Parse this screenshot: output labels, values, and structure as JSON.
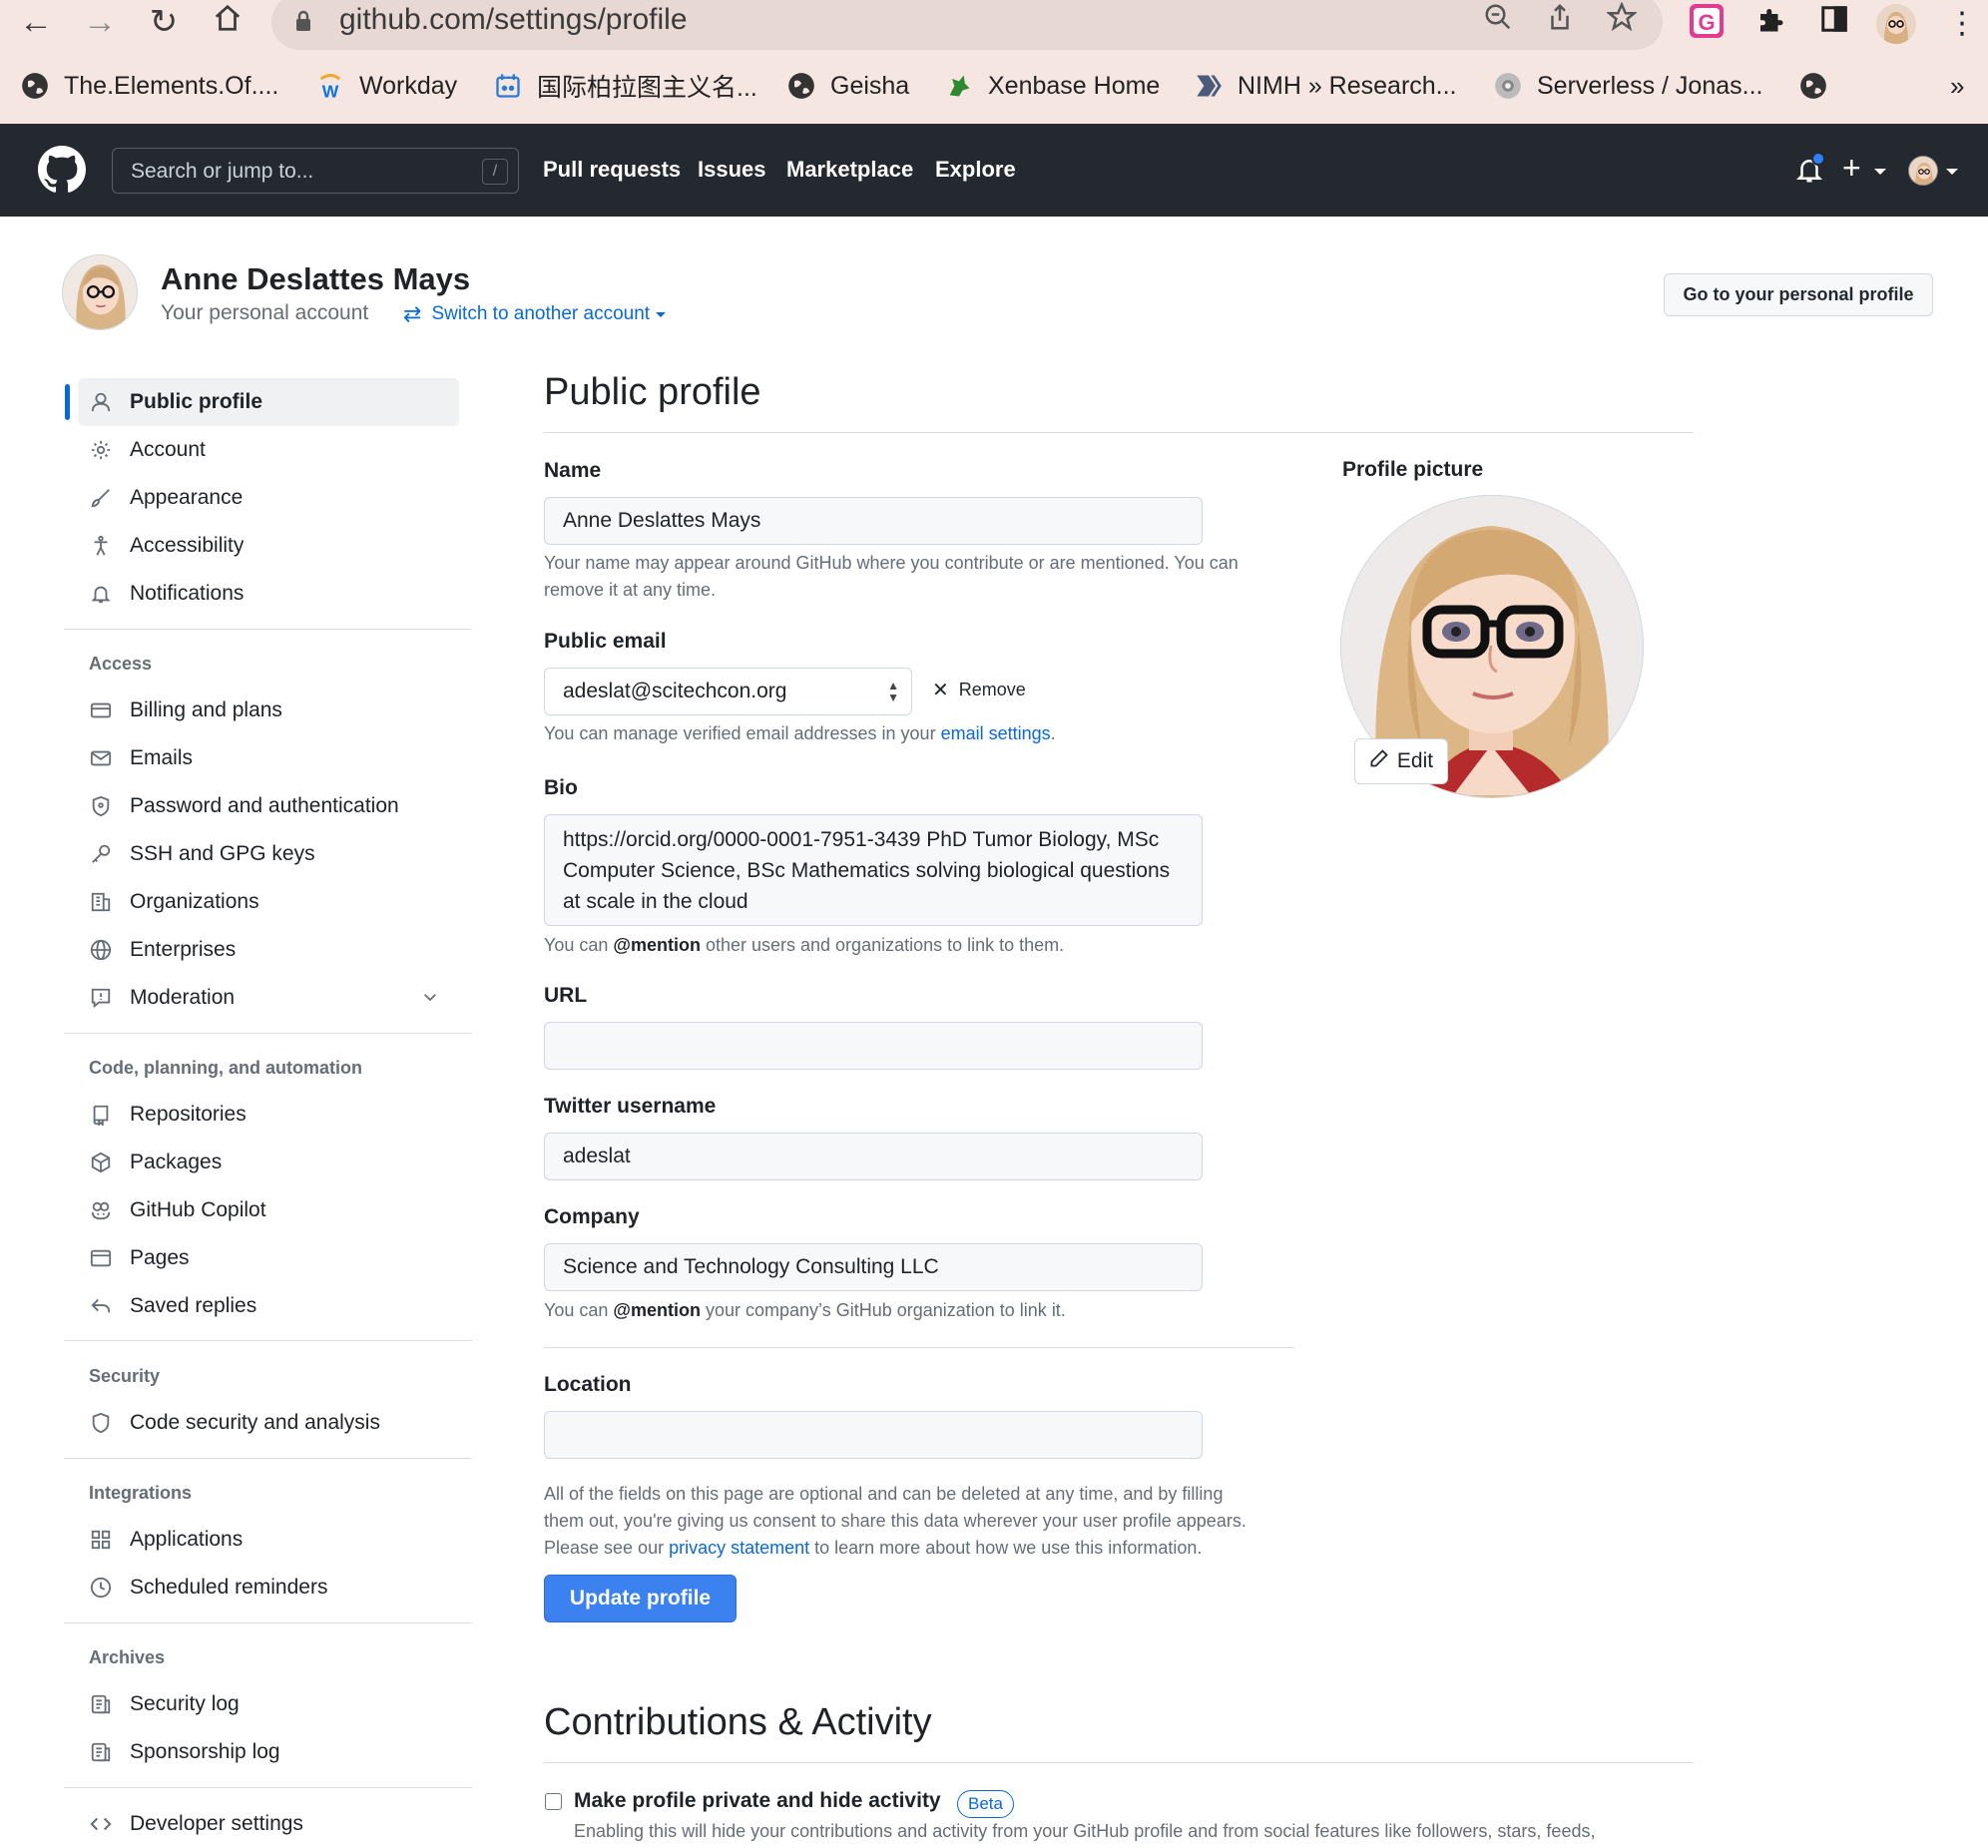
{
  "browser": {
    "url": "github.com/settings/profile",
    "bookmarks": [
      {
        "label": "The.Elements.Of...."
      },
      {
        "label": "Workday"
      },
      {
        "label": "国际柏拉图主义名..."
      },
      {
        "label": "Geisha"
      },
      {
        "label": "Xenbase Home"
      },
      {
        "label": "NIMH » Research..."
      },
      {
        "label": "Serverless / Jonas..."
      }
    ],
    "more": "»"
  },
  "header": {
    "search_placeholder": "Search or jump to...",
    "slash": "/",
    "nav": [
      "Pull requests",
      "Issues",
      "Marketplace",
      "Explore"
    ],
    "plus": "+"
  },
  "account": {
    "name": "Anne Deslattes Mays",
    "subtitle": "Your personal account",
    "switch": "Switch to another account",
    "go_profile": "Go to your personal profile"
  },
  "sidebar": {
    "top": [
      "Public profile",
      "Account",
      "Appearance",
      "Accessibility",
      "Notifications"
    ],
    "access_head": "Access",
    "access": [
      "Billing and plans",
      "Emails",
      "Password and authentication",
      "SSH and GPG keys",
      "Organizations",
      "Enterprises",
      "Moderation"
    ],
    "code_head": "Code, planning, and automation",
    "code": [
      "Repositories",
      "Packages",
      "GitHub Copilot",
      "Pages",
      "Saved replies"
    ],
    "security_head": "Security",
    "security": [
      "Code security and analysis"
    ],
    "integrations_head": "Integrations",
    "integrations": [
      "Applications",
      "Scheduled reminders"
    ],
    "archives_head": "Archives",
    "archives": [
      "Security log",
      "Sponsorship log"
    ],
    "developer": "Developer settings"
  },
  "main": {
    "title": "Public profile",
    "name_label": "Name",
    "name_value": "Anne Deslattes Mays",
    "name_note": "Your name may appear around GitHub where you contribute or are mentioned. You can remove it at any time.",
    "email_label": "Public email",
    "email_value": "adeslat@scitechcon.org",
    "remove": "Remove",
    "email_note_pre": "You can manage verified email addresses in your ",
    "email_note_link": "email settings",
    "email_note_post": ".",
    "bio_label": "Bio",
    "bio_value": "https://orcid.org/0000-0001-7951-3439 PhD Tumor Biology, MSc Computer Science, BSc Mathematics solving biological questions at scale in the cloud",
    "bio_note_pre": "You can ",
    "bio_note_mention": "@mention",
    "bio_note_post": " other users and organizations to link to them.",
    "url_label": "URL",
    "url_value": "",
    "twitter_label": "Twitter username",
    "twitter_value": "adeslat",
    "company_label": "Company",
    "company_value": "Science and Technology Consulting LLC",
    "company_note_pre": "You can ",
    "company_note_mention": "@mention",
    "company_note_post": " your company’s GitHub organization to link it.",
    "location_label": "Location",
    "location_value": "",
    "consent_1": "All of the fields on this page are optional and can be deleted at any time, and by filling",
    "consent_2": "them out, you're giving us consent to share this data wherever your user profile appears.",
    "consent_3_pre": "Please see our ",
    "consent_3_link": "privacy statement",
    "consent_3_post": " to learn more about how we use this information.",
    "update": "Update profile",
    "picture_label": "Profile picture",
    "edit": "Edit",
    "contrib_title": "Contributions & Activity",
    "private_label": "Make profile private and hide activity",
    "beta": "Beta",
    "private_note": "Enabling this will hide your contributions and activity from your GitHub profile and from social features like followers, stars, feeds,"
  },
  "colors": {
    "accent": "#0969da",
    "header_bg": "#24292f",
    "button": "#3b82f0"
  }
}
